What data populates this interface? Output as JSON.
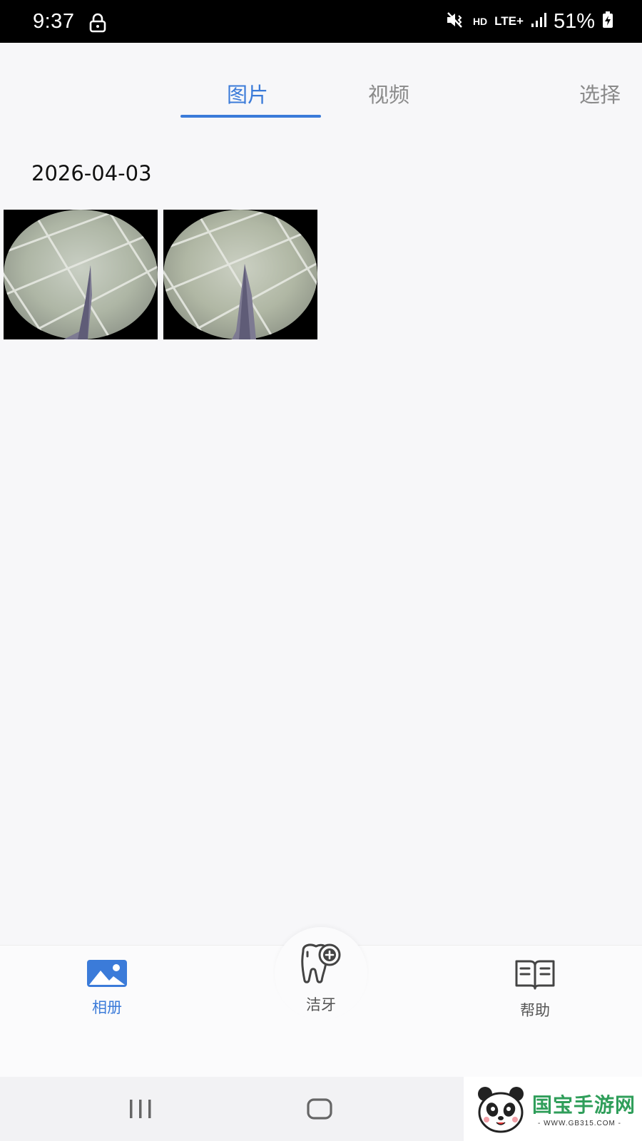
{
  "status_bar": {
    "time": "9:37",
    "network_hd": "HD",
    "network_type": "LTE+",
    "battery_percent": "51%"
  },
  "tabs": {
    "images": "图片",
    "videos": "视频",
    "select": "选择",
    "active": "images"
  },
  "gallery": {
    "date": "2026-04-03",
    "photos": [
      {
        "icon": "fisheye-photo-thumbnail"
      },
      {
        "icon": "fisheye-photo-thumbnail"
      }
    ]
  },
  "bottom_nav": {
    "album": "相册",
    "clean_teeth": "洁牙",
    "help": "帮助",
    "active": "album"
  },
  "watermark": {
    "title": "国宝手游网",
    "url": "- WWW.GB315.COM -"
  },
  "colors": {
    "accent": "#3b7bd9",
    "inactive": "#8a8a8a",
    "background": "#f7f7f9"
  }
}
